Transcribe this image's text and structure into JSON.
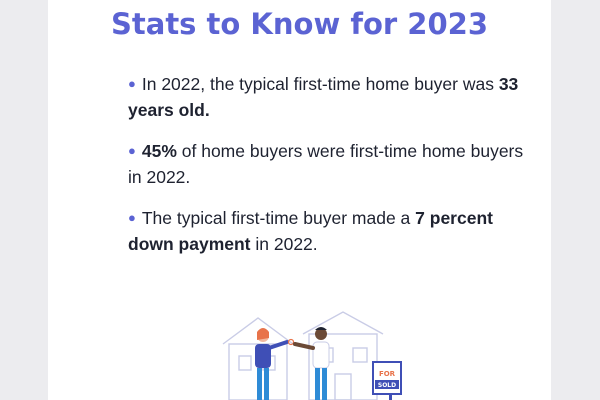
{
  "header": {
    "title_line2": "Stats to Know for 2023"
  },
  "stats": [
    {
      "bullet": "●",
      "pre": "In 2022, the typical first-time home buyer was ",
      "bold": "33 years old.",
      "post": ""
    },
    {
      "bullet": "●",
      "pre": "",
      "bold": "45%",
      "post": " of home buyers were first-time home buyers in 2022."
    },
    {
      "bullet": "●",
      "pre": "The typical first-time buyer made a ",
      "bold": "7 percent down payment",
      "post": " in 2022."
    }
  ],
  "illustration": {
    "sign_top": "FOR",
    "sign_bottom": "SOLD"
  },
  "colors": {
    "accent": "#5b63d3",
    "text": "#1e2230",
    "background": "#ececef",
    "card": "#ffffff"
  }
}
